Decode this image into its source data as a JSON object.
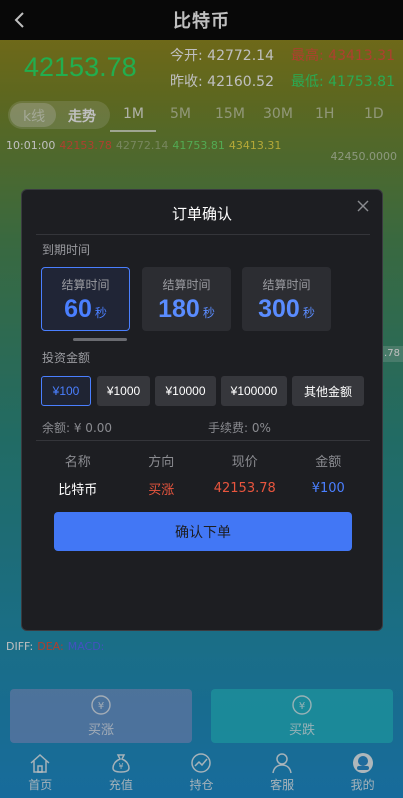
{
  "header": {
    "title": "比特币"
  },
  "quote": {
    "price": "42153.78",
    "open_label": "今开:",
    "open_value": "42772.14",
    "high_label": "最高:",
    "high_value": "43413.31",
    "prev_label": "昨收:",
    "prev_value": "42160.52",
    "low_label": "最低:",
    "low_value": "41753.81"
  },
  "chart_tabs": [
    "k线",
    "走势",
    "1M",
    "5M",
    "15M",
    "30M",
    "1H",
    "1D"
  ],
  "chart_info": {
    "time": "10:01:00",
    "v1": "42153.78",
    "v2": "42772.14",
    "v3": "41753.81",
    "v4": "43413.31",
    "axis_top": "42450.0000",
    "side_tag": ".78"
  },
  "macd": {
    "diff": "DIFF:",
    "dea": "DEA:",
    "macd": "MACD:"
  },
  "modal": {
    "title": "订单确认",
    "expiry_label": "到期时间",
    "time_cards": [
      {
        "label": "结算时间",
        "value": "60",
        "unit": "秒"
      },
      {
        "label": "结算时间",
        "value": "180",
        "unit": "秒"
      },
      {
        "label": "结算时间",
        "value": "300",
        "unit": "秒"
      }
    ],
    "invest_label": "投资金额",
    "amounts": [
      "¥100",
      "¥1000",
      "¥10000",
      "¥100000",
      "其他金额"
    ],
    "balance": "余额: ¥ 0.00",
    "fee": "手续费: 0%",
    "summary_headers": [
      "名称",
      "方向",
      "现价",
      "金额"
    ],
    "summary_values": [
      "比特币",
      "买涨",
      "42153.78",
      "¥100"
    ],
    "confirm_label": "确认下单"
  },
  "trade": {
    "up_label": "买涨",
    "down_label": "买跌"
  },
  "nav": [
    "首页",
    "充值",
    "持仓",
    "客服",
    "我的"
  ]
}
